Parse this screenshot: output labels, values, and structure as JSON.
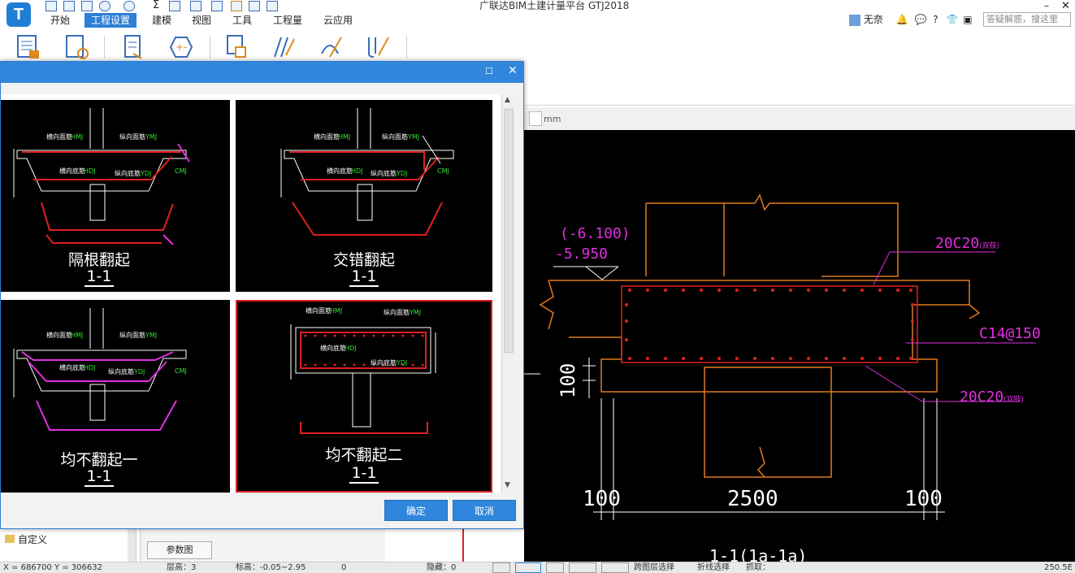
{
  "app": {
    "logo_letter": "T",
    "window_title": "广联达BIM土建计量平台 GTJ2018"
  },
  "menu": {
    "tabs": [
      "开始",
      "工程设置",
      "建模",
      "视图",
      "工具",
      "工程量",
      "云应用"
    ],
    "active_index": 1
  },
  "user": {
    "name": "无奈",
    "help": "?",
    "search_placeholder": "答疑解惑，搜这里"
  },
  "ribbon": {
    "icons": [
      "project-info-icon",
      "calc-settings-icon",
      "rebar-settings-icon",
      "floor-settings-icon",
      "layer-icon",
      "rebar-design-icon",
      "rebar-edit-icon",
      "rebar-compare-icon"
    ]
  },
  "canvas": {
    "unit": "mm",
    "annotations": {
      "elev_top": "(-6.100)",
      "elev_bottom": "-5.950",
      "rebar_top": "20C20",
      "rebar_top_note": "(双肢)",
      "rebar_mid": "C14@150",
      "rebar_bottom": "20C20",
      "rebar_bottom_note": "(双肢)",
      "dim_left": "100",
      "dim_center": "2500",
      "dim_right": "100",
      "dim_vertical": "100",
      "section_label": "1-1(1a-1a)"
    }
  },
  "dialog": {
    "title": "",
    "options": [
      {
        "title": "隔根翻起",
        "section": "1-1",
        "selected": false
      },
      {
        "title": "交错翻起",
        "section": "1-1",
        "selected": false
      },
      {
        "title": "均不翻起一",
        "section": "1-1",
        "selected": false
      },
      {
        "title": "均不翻起二",
        "section": "1-1",
        "selected": true
      }
    ],
    "labels": {
      "top_transverse": "横向面筋",
      "top_longitudinal": "纵向面筋",
      "bottom_transverse": "横向底筋",
      "bottom_longitudinal": "纵向底筋",
      "code_hmj": "HMJ",
      "code_ymj": "YMJ",
      "code_hdj": "HDJ",
      "code_ydj": "YDJ",
      "code_cmj": "CMJ"
    },
    "ok_label": "确定",
    "cancel_label": "取消"
  },
  "panels": {
    "tree_item": "自定义",
    "param_button": "参数图"
  },
  "statusbar": {
    "left_text": "X = 686700 Y = 306632",
    "layer": "层高：3",
    "floor": "标高：-0.05~2.95",
    "value": "0",
    "hidden": "隐藏：0",
    "select_layer": "跨图层选择",
    "fold_select": "折线选择",
    "grab": "抓取：",
    "scale": "250.5E"
  },
  "colors": {
    "accent": "#2f86dc",
    "selected_card": "#e02020",
    "cad_red": "#e02020",
    "cad_orange": "#e07a20",
    "cad_magenta": "#e030e0",
    "cad_white": "#ffffff"
  }
}
